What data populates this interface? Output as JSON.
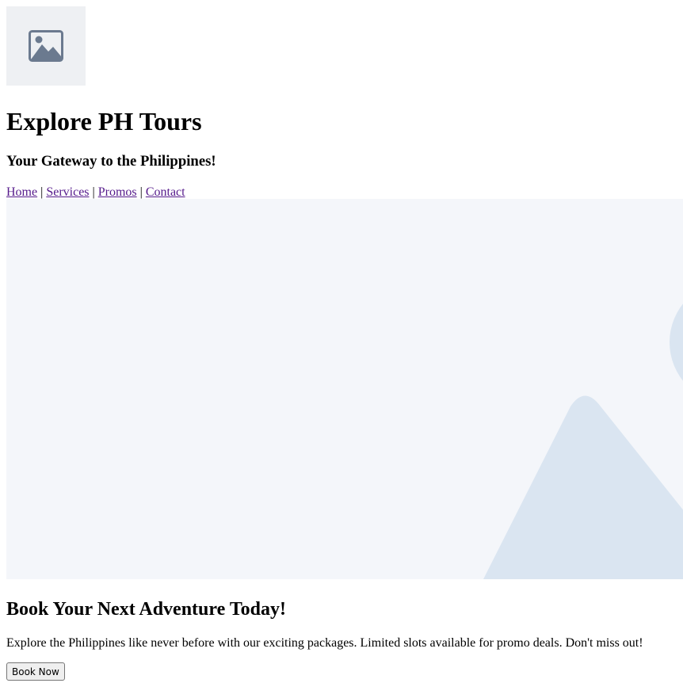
{
  "header": {
    "logo_icon": "image-placeholder-icon",
    "title": "Explore PH Tours",
    "tagline": "Your Gateway to the Philippines!"
  },
  "nav": {
    "items": [
      {
        "label": "Home"
      },
      {
        "label": "Services"
      },
      {
        "label": "Promos"
      },
      {
        "label": "Contact"
      }
    ],
    "separator": "|"
  },
  "hero": {
    "image_icon": "image-placeholder-icon"
  },
  "promo": {
    "heading": "Book Your Next Adventure Today!",
    "text": "Explore the Philippines like never before with our exciting packages. Limited slots available for promo deals. Don't miss out!",
    "button_label": "Book Now"
  },
  "colors": {
    "link": "#551a8b",
    "placeholder_bg": "#eef0f3",
    "placeholder_icon": "#6b7a8f",
    "hero_bg": "#f4f6fa",
    "hero_shape": "#dae5f1"
  }
}
